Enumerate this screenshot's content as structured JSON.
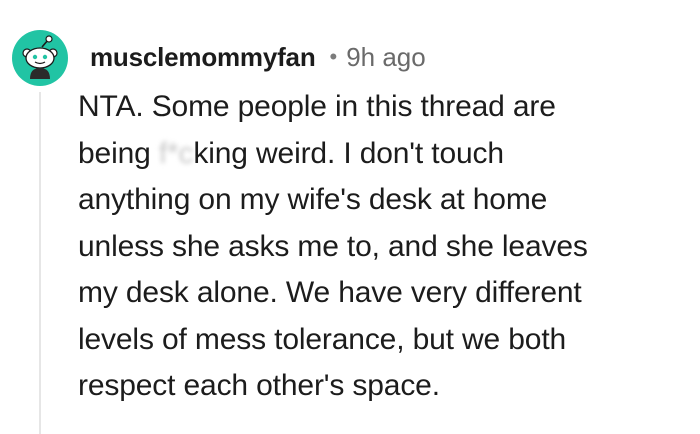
{
  "comment": {
    "username": "musclemommyfan",
    "separator": "•",
    "time_ago": "9h ago",
    "avatar_icon": "snoo-avatar-icon",
    "avatar_color": "#21c4a4",
    "body_lines": [
      {
        "before": "NTA. Some people in this thread are",
        "censored": "",
        "after": ""
      },
      {
        "before": "being ",
        "censored": "f*c",
        "after": "king weird. I don't touch"
      },
      {
        "before": "anything on my wife's desk at home",
        "censored": "",
        "after": ""
      },
      {
        "before": "unless she asks me to, and she leaves",
        "censored": "",
        "after": ""
      },
      {
        "before": "my desk alone. We have very different",
        "censored": "",
        "after": ""
      },
      {
        "before": "levels of mess tolerance, but we both",
        "censored": "",
        "after": ""
      },
      {
        "before": "respect each other's space.",
        "censored": "",
        "after": ""
      }
    ]
  }
}
